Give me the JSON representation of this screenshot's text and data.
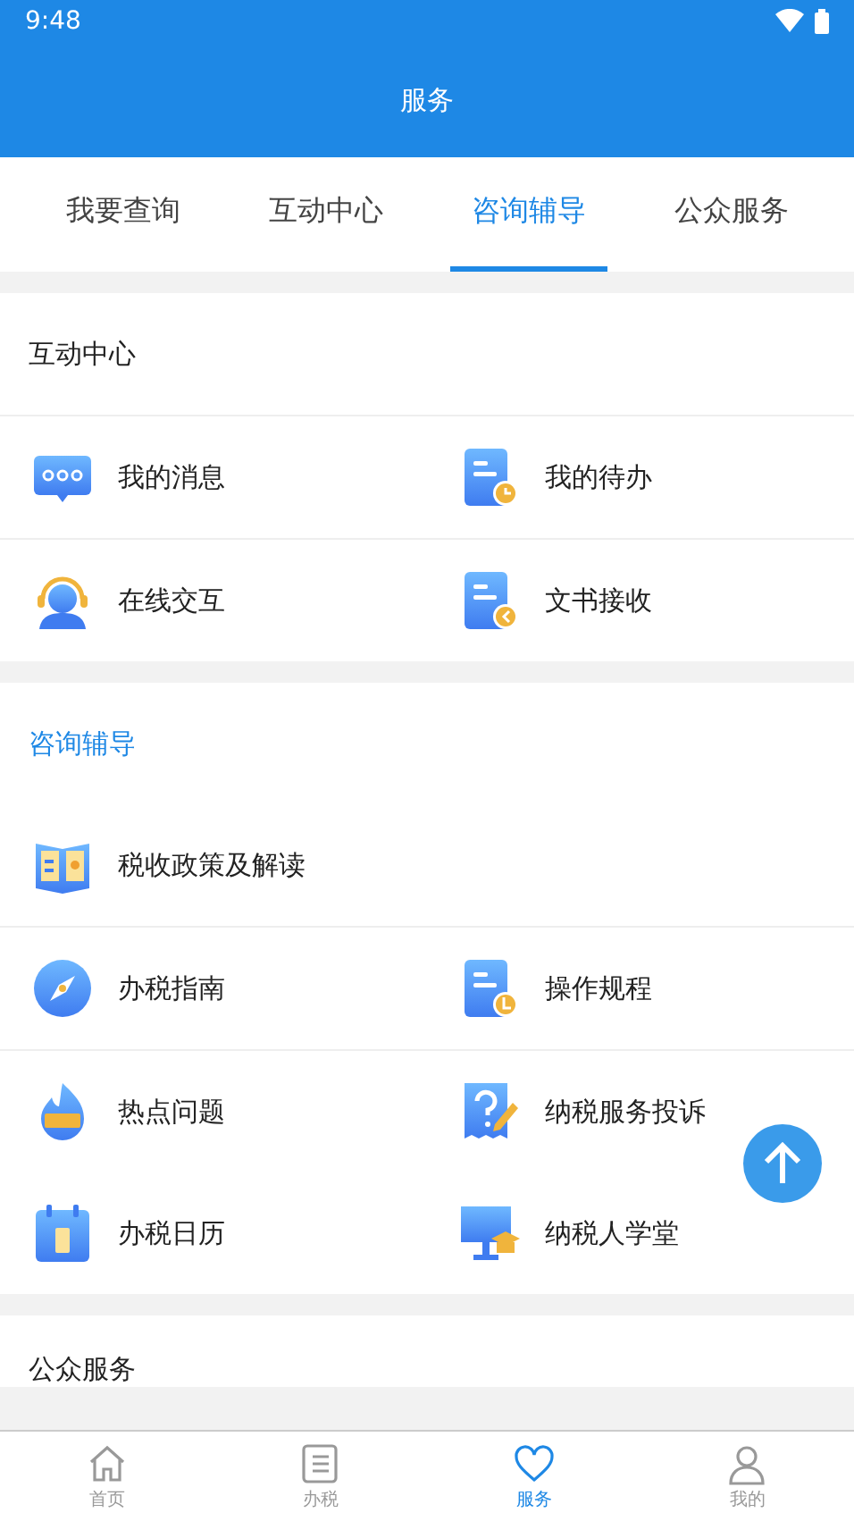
{
  "status_bar": {
    "time": "9:48"
  },
  "header": {
    "title": "服务"
  },
  "tabs": [
    {
      "label": "我要查询",
      "selected": false
    },
    {
      "label": "互动中心",
      "selected": false
    },
    {
      "label": "咨询辅导",
      "selected": true
    },
    {
      "label": "公众服务",
      "selected": false
    }
  ],
  "sections": [
    {
      "title": "互动中心",
      "active": false,
      "rows": [
        [
          {
            "label": "我的消息"
          },
          {
            "label": "我的待办"
          }
        ],
        [
          {
            "label": "在线交互"
          },
          {
            "label": "文书接收"
          }
        ]
      ]
    },
    {
      "title": "咨询辅导",
      "active": true,
      "rows": [
        [
          {
            "label": "税收政策及解读"
          }
        ],
        [
          {
            "label": "办税指南"
          },
          {
            "label": "操作规程"
          }
        ],
        [
          {
            "label": "热点问题"
          },
          {
            "label": "纳税服务投诉"
          }
        ],
        [
          {
            "label": "办税日历"
          },
          {
            "label": "纳税人学堂"
          }
        ]
      ]
    },
    {
      "title": "公众服务",
      "active": false
    }
  ],
  "bottom_nav": [
    {
      "label": "首页",
      "selected": false
    },
    {
      "label": "办税",
      "selected": false
    },
    {
      "label": "服务",
      "selected": true
    },
    {
      "label": "我的",
      "selected": false
    }
  ]
}
